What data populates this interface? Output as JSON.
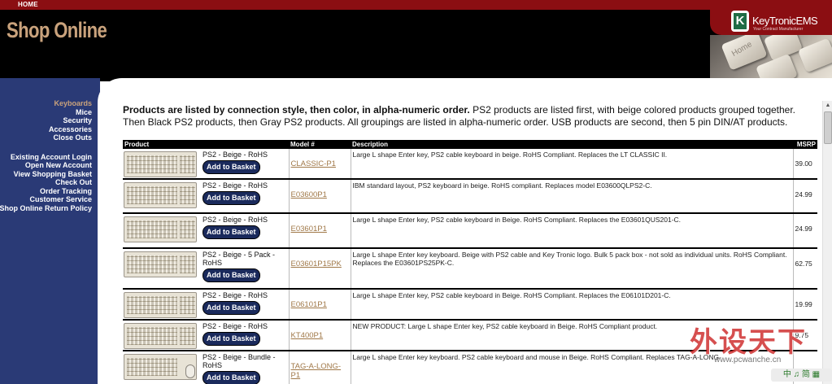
{
  "topnav": {
    "home": "HOME"
  },
  "header": {
    "title": "Shop Online",
    "logo_text": "KeyTronicEMS",
    "logo_tagline": "Your Contract Manufacturer",
    "photo_key_label": "Home"
  },
  "sidebar": {
    "group1": [
      {
        "label": "Keyboards",
        "active": true
      },
      {
        "label": "Mice"
      },
      {
        "label": "Security"
      },
      {
        "label": "Accessories"
      },
      {
        "label": "Close Outs"
      }
    ],
    "group2": [
      {
        "label": "Existing Account Login"
      },
      {
        "label": "Open New Account"
      },
      {
        "label": "View Shopping Basket"
      },
      {
        "label": "Check Out"
      },
      {
        "label": "Order Tracking"
      },
      {
        "label": "Customer Service"
      },
      {
        "label": "Shop Online Return Policy"
      }
    ]
  },
  "intro": {
    "bold": "Products are listed by connection style, then color, in alpha-numeric order.",
    "rest": " PS2 products are listed first, with beige colored products grouped together. Then Black PS2 products, then Gray PS2 products. All groupings are listed in alpha-numeric order. USB products are second, then 5 pin DIN/AT products."
  },
  "table": {
    "headers": {
      "product": "Product",
      "model": "Model #",
      "description": "Description",
      "msrp": "MSRP"
    },
    "basket_label": "Add to Basket",
    "rows": [
      {
        "name": "PS2 - Beige - RoHS",
        "model": "CLASSIC-P1",
        "description": "Large L shape Enter key, PS2 cable keyboard in beige. RoHS Compliant. Replaces the LT CLASSIC II.",
        "msrp": "39.00"
      },
      {
        "name": "PS2 - Beige - RoHS",
        "model": "E03600P1",
        "description": "IBM standard layout, PS2 keyboard in beige. RoHS compliant. Replaces model E03600QLPS2-C.",
        "msrp": "24.99"
      },
      {
        "name": "PS2 - Beige - RoHS",
        "model": "E03601P1",
        "description": "Large L shape Enter key, PS2 cable keyboard in Beige. RoHS Compliant. Replaces the E03601QUS201-C.",
        "msrp": "24.99"
      },
      {
        "name": "PS2 - Beige - 5 Pack - RoHS",
        "model": "E03601P15PK",
        "description": "Large L shape Enter key keyboard. Beige with PS2 cable and Key Tronic logo. Bulk 5 pack box - not sold as individual units. RoHS Compliant. Replaces the E03601PS25PK-C.",
        "msrp": "62.75"
      },
      {
        "name": "PS2 - Beige - RoHS",
        "model": "E06101P1",
        "description": "Large L shape Enter key, PS2 cable keyboard in Beige. RoHS Compliant. Replaces the E06101D201-C.",
        "msrp": "19.99"
      },
      {
        "name": "PS2 - Beige - RoHS",
        "model": "KT400P1",
        "description": "NEW PRODUCT: Large L shape Enter key, PS2 cable keyboard in Beige. RoHS Compliant product.",
        "msrp": "9.75"
      },
      {
        "name": "PS2 - Beige - Bundle - RoHS",
        "model": "TAG-A-LONG-P1",
        "description": "Large L shape Enter key keyboard. PS2 cable keyboard and mouse in Beige. RoHS Compliant. Replaces TAG-A-LONG-",
        "msrp": ""
      }
    ]
  },
  "watermark": {
    "text": "外设天下",
    "url": "www.pcwanche.cn",
    "bar": "中 ♫ 简 ▦"
  }
}
